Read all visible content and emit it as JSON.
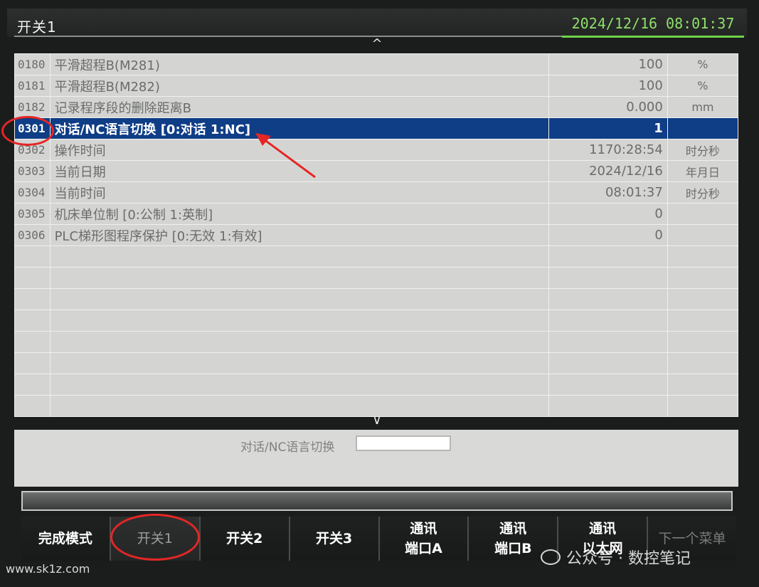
{
  "header": {
    "title": "开关1",
    "datetime": "2024/12/16 08:01:37"
  },
  "icons": {
    "up": "^",
    "down": "∨"
  },
  "params": [
    {
      "no": "0180",
      "name": "平滑超程B(M281)",
      "value": "100",
      "unit": "%"
    },
    {
      "no": "0181",
      "name": "平滑超程B(M282)",
      "value": "100",
      "unit": "%"
    },
    {
      "no": "0182",
      "name": "记录程序段的删除距离B",
      "value": "0.000",
      "unit": "mm"
    },
    {
      "no": "0301",
      "name": "对话/NC语言切换 [0:对话  1:NC]",
      "value": "1",
      "unit": ""
    },
    {
      "no": "0302",
      "name": "操作时间",
      "value": "1170:28:54",
      "unit": "时分秒"
    },
    {
      "no": "0303",
      "name": "当前日期",
      "value": "2024/12/16",
      "unit": "年月日"
    },
    {
      "no": "0304",
      "name": "当前时间",
      "value": "08:01:37",
      "unit": "时分秒"
    },
    {
      "no": "0305",
      "name": "机床单位制 [0:公制  1:英制]",
      "value": "0",
      "unit": ""
    },
    {
      "no": "0306",
      "name": "PLC梯形图程序保护 [0:无效  1:有效]",
      "value": "0",
      "unit": ""
    }
  ],
  "input": {
    "label": "对话/NC语言切换",
    "value": ""
  },
  "softkeys": [
    {
      "line1": "完成模式",
      "line2": ""
    },
    {
      "line1": "开关1",
      "line2": ""
    },
    {
      "line1": "开关2",
      "line2": ""
    },
    {
      "line1": "开关3",
      "line2": ""
    },
    {
      "line1": "通讯",
      "line2": "端口A"
    },
    {
      "line1": "通讯",
      "line2": "端口B"
    },
    {
      "line1": "通讯",
      "line2": "以太网"
    },
    {
      "line1": "下一个菜单",
      "line2": ""
    }
  ],
  "watermarks": {
    "site": "www.sk1z.com",
    "account": "公众号 · 数控笔记"
  },
  "colors": {
    "selected_row": "#0f3d86",
    "annotation": "#e52626",
    "clock": "#8ee06a"
  }
}
